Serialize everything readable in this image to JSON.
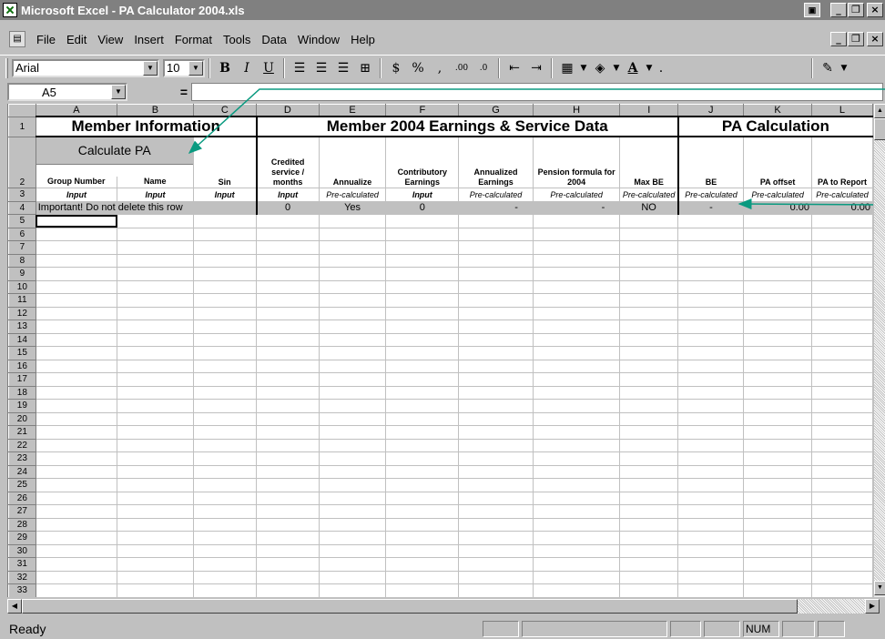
{
  "window": {
    "title": "Microsoft Excel - PA Calculator 2004.xls"
  },
  "menu": {
    "items": [
      "File",
      "Edit",
      "View",
      "Insert",
      "Format",
      "Tools",
      "Data",
      "Window",
      "Help"
    ]
  },
  "toolbar": {
    "font": "Arial",
    "size": "10",
    "bold": "B",
    "italic": "I",
    "underline": "U",
    "currency": "$",
    "percent": "%",
    "comma": ",",
    "font_color_letter": "A"
  },
  "formula_bar": {
    "name_box": "A5",
    "equals": "=",
    "content": ""
  },
  "sheet": {
    "columns": [
      "A",
      "B",
      "C",
      "D",
      "E",
      "F",
      "G",
      "H",
      "I",
      "J",
      "K",
      "L"
    ],
    "section_member_info": "Member Information",
    "section_earnings": "Member 2004 Earnings & Service Data",
    "section_pa_calc": "PA Calculation",
    "calc_button": "Calculate PA",
    "headers": [
      "Group Number",
      "Name",
      "Sin",
      "Credited service / months",
      "Annualize",
      "Contributory Earnings",
      "Annualized Earnings",
      "Pension formula for 2004",
      "Max BE",
      "BE",
      "PA offset",
      "PA to Report"
    ],
    "row3": [
      "Input",
      "Input",
      "Input",
      "Input",
      "Pre-calculated",
      "Input",
      "Pre-calculated",
      "Pre-calculated",
      "Pre-calculated",
      "Pre-calculated",
      "Pre-calculated",
      "Pre-calculated"
    ],
    "row4": {
      "note": "Important! Do not delete this row",
      "D": "0",
      "E": "Yes",
      "F": "0",
      "G": "-",
      "H": "-",
      "I": "NO",
      "J": "-",
      "K": "0.00",
      "L": "0.00"
    },
    "empty_rows": [
      "5",
      "6",
      "7",
      "8",
      "9",
      "10",
      "11",
      "12",
      "13",
      "14",
      "15",
      "16",
      "17",
      "18",
      "19",
      "20",
      "21",
      "22",
      "23",
      "24",
      "25",
      "26",
      "27",
      "28",
      "29",
      "30",
      "31",
      "32",
      "33"
    ]
  },
  "status": {
    "text": "Ready",
    "num": "NUM"
  }
}
